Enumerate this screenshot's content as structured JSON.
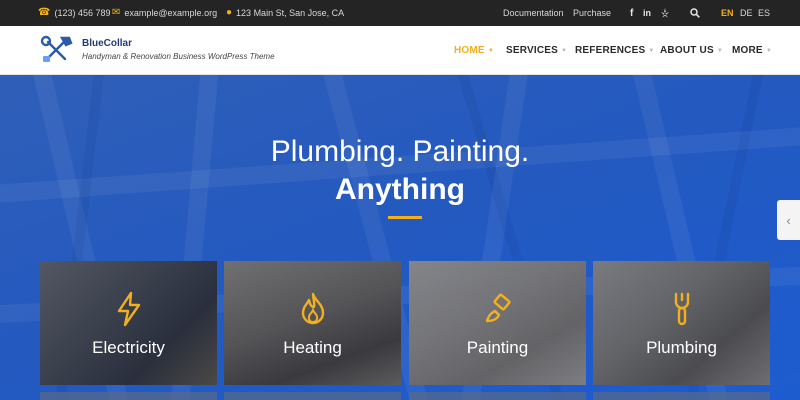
{
  "topbar": {
    "phone": "(123) 456 789",
    "email": "example@example.org",
    "address": "123 Main St, San Jose, CA",
    "links": [
      "Documentation",
      "Purchase"
    ],
    "social": [
      "f",
      "in",
      "yelp"
    ],
    "languages": [
      "EN",
      "DE",
      "ES"
    ],
    "active_language": "EN"
  },
  "header": {
    "brand": "BlueCollar",
    "tagline": "Handyman & Renovation Business WordPress Theme",
    "nav": [
      {
        "label": "HOME",
        "active": true
      },
      {
        "label": "SERVICES",
        "active": false
      },
      {
        "label": "REFERENCES",
        "active": false
      },
      {
        "label": "ABOUT US",
        "active": false
      },
      {
        "label": "MORE",
        "active": false
      }
    ]
  },
  "hero": {
    "line1": "Plumbing. Painting.",
    "line2": "Anything"
  },
  "services": [
    {
      "label": "Electricity",
      "icon": "lightning-bolt-icon"
    },
    {
      "label": "Heating",
      "icon": "flame-icon"
    },
    {
      "label": "Painting",
      "icon": "paint-brush-icon"
    },
    {
      "label": "Plumbing",
      "icon": "wrench-icon"
    }
  ],
  "colors": {
    "accent": "#f2b01e",
    "topbar_bg": "#242424",
    "hero_blue": "#2459bf",
    "brand_navy": "#1f3c78"
  }
}
